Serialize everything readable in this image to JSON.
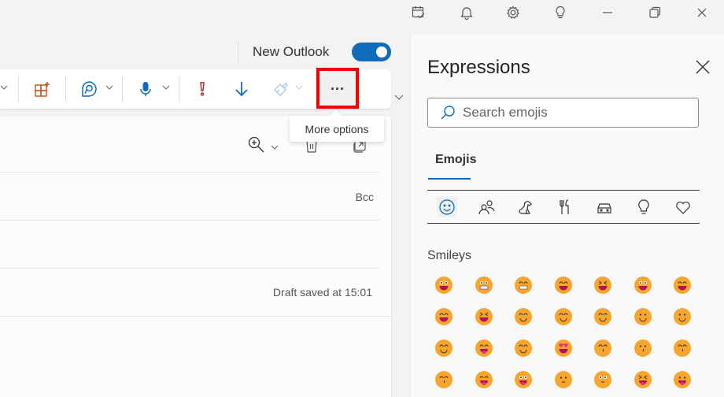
{
  "titlebar": {
    "icons": [
      "my-day-icon",
      "notifications-icon",
      "settings-icon",
      "tips-icon",
      "minimize-icon",
      "restore-icon",
      "close-icon"
    ]
  },
  "new_outlook": {
    "label": "New Outlook",
    "enabled": true
  },
  "ribbon": {
    "items": [
      "apps-icon",
      "loop-icon",
      "dictate-icon",
      "importance-icon",
      "low-importance-icon",
      "format-painter-icon"
    ],
    "more_options_label": "...",
    "tooltip": "More options",
    "colors": {
      "apps": "#c4501b",
      "loop": "#0f6cbd",
      "dictate": "#0f6cbd",
      "importance": "#a4262c",
      "arrow": "#0f6cbd",
      "painter": "#a6c8e8",
      "highlight_box": "#f00000"
    }
  },
  "compose": {
    "bcc_label": "Bcc",
    "draft_status": "Draft saved at 15:01"
  },
  "expressions": {
    "title": "Expressions",
    "search_placeholder": "Search emojis",
    "tab": "Emojis",
    "categories": [
      "smileys",
      "people",
      "animals",
      "food",
      "travel",
      "objects",
      "symbols"
    ],
    "section": "Smileys",
    "emojis": [
      "grinning-face-big-eyes",
      "grimacing-face",
      "beaming-face",
      "face-with-tears-of-joy",
      "rolling-on-floor-laughing",
      "grinning-face-open",
      "grinning-face-smiling-eyes",
      "grinning-face-with-sweat",
      "grinning-squinting-face",
      "smiling-face-with-halo",
      "winking-face",
      "smiling-face-smiling-eyes",
      "slightly-smiling-face",
      "upside-down-face",
      "smiling-face-blush",
      "face-savoring-food",
      "relieved-face",
      "smiling-face-heart-eyes",
      "face-blowing-kiss",
      "kissing-face",
      "kissing-face-smiling-eyes",
      "kissing-face-closed-eyes",
      "winking-face-tongue",
      "zany-face",
      "face-raised-eyebrow",
      "face-with-monocle",
      "squinting-face-tongue",
      "money-mouth-face"
    ]
  }
}
